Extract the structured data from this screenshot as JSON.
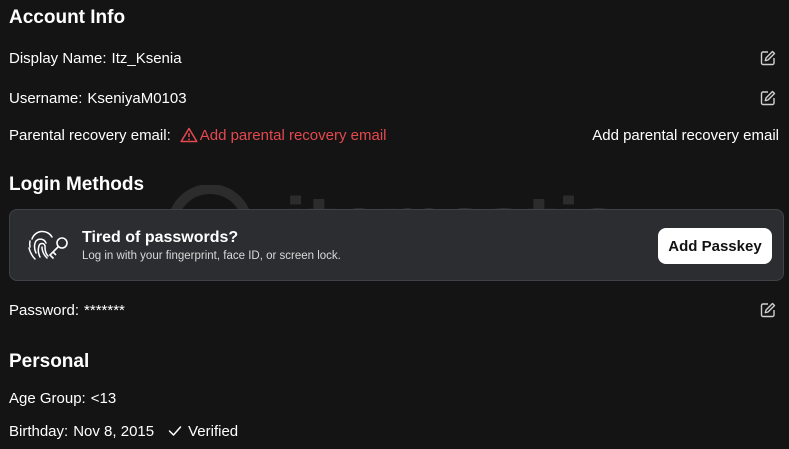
{
  "account_info": {
    "heading": "Account Info",
    "display_name": {
      "label": "Display Name:",
      "value": "Itz_Ksenia"
    },
    "username": {
      "label": "Username:",
      "value": "KseniyaM0103"
    },
    "parental_email": {
      "label": "Parental recovery email:",
      "warning_link": "Add parental recovery email",
      "action_link": "Add parental recovery email"
    }
  },
  "login_methods": {
    "heading": "Login Methods",
    "passkey": {
      "title": "Tired of passwords?",
      "subtitle": "Log in with your fingerprint, face ID, or screen lock.",
      "button": "Add Passkey"
    },
    "password": {
      "label": "Password:",
      "value": "*******"
    }
  },
  "personal": {
    "heading": "Personal",
    "age_group": {
      "label": "Age Group:",
      "value": "<13"
    },
    "birthday": {
      "label": "Birthday:",
      "value": "Nov 8, 2015",
      "status": "Verified"
    }
  },
  "watermark": "itemsatis",
  "icons": {
    "edit": "pencil-square-icon",
    "warning": "warning-triangle-icon",
    "passkey": "fingerprint-key-icon",
    "check": "checkmark-icon"
  },
  "colors": {
    "background": "#141414",
    "card": "#2b2d30",
    "warning": "#e5484d",
    "text": "#ffffff"
  }
}
